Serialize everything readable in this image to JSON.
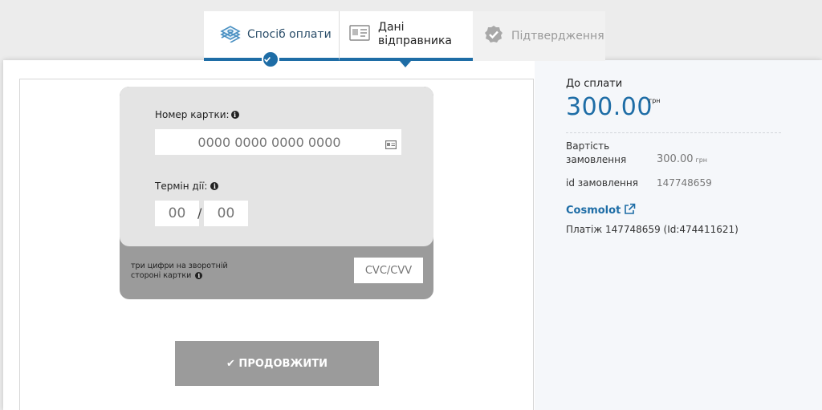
{
  "tabs": [
    {
      "label": "Спосіб оплати",
      "icon": "money-icon",
      "state": "completed"
    },
    {
      "label": "Дані відправника",
      "icon": "id-card-icon",
      "state": "active"
    },
    {
      "label": "Підтвердження",
      "icon": "check-badge-icon",
      "state": "disabled"
    }
  ],
  "card": {
    "number_label": "Номер картки:",
    "number_placeholder": "0000 0000 0000 0000",
    "expiry_label": "Термін дії:",
    "month_placeholder": "00",
    "year_placeholder": "00",
    "separator": "/",
    "cvc_hint": "три цифри на зворотній стороні картки",
    "cvc_placeholder": "CVC/CVV"
  },
  "continue_label": "✔ ПРОДОВЖИТИ",
  "summary": {
    "pay_label": "До сплати",
    "amount": "300.00",
    "currency": "грн",
    "order_cost_label": "Вартість замовлення",
    "order_cost_value": "300.00",
    "order_id_label": "id замовлення",
    "order_id_value": "147748659",
    "merchant": "Cosmolot",
    "payment_desc": "Платіж 147748659 (Id:474411621)"
  },
  "colors": {
    "accent": "#1e6da6",
    "card_front": "#e4e4e4",
    "card_back": "#9b9b9b",
    "button_disabled": "#9b9b9b"
  }
}
